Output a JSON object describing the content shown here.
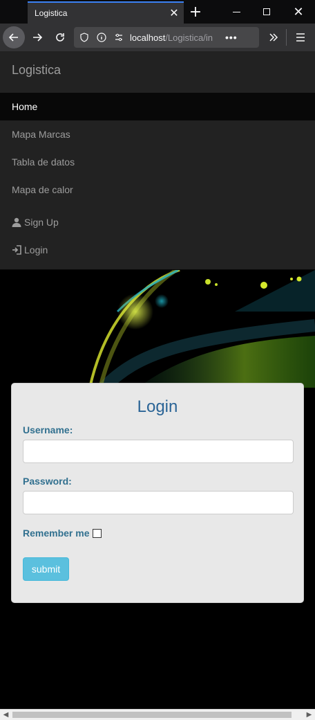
{
  "browser": {
    "tab_title": "Logistica",
    "url_main": "localhost",
    "url_rest": "/Logistica/in",
    "tab_close_glyph": "✕",
    "new_tab_glyph": "+",
    "more_glyph": "•••"
  },
  "app": {
    "brand": "Logistica",
    "nav": [
      {
        "label": "Home",
        "active": true
      },
      {
        "label": "Mapa Marcas"
      },
      {
        "label": "Tabla de datos"
      },
      {
        "label": "Mapa de calor"
      },
      {
        "label": "Sign Up",
        "icon": "user-icon"
      },
      {
        "label": "Login",
        "icon": "log-in-icon"
      }
    ]
  },
  "login": {
    "title": "Login",
    "username_label": "Username:",
    "username_value": "",
    "password_label": "Password:",
    "password_value": "",
    "remember_label": "Remember me",
    "remember_checked": false,
    "submit_label": "submit"
  },
  "colors": {
    "navbar_bg": "#222222",
    "active_item_bg": "#080808",
    "panel_bg": "#e8e8e8",
    "label_color": "#31708f",
    "title_color": "#2a6496",
    "submit_bg": "#5bc0de"
  }
}
